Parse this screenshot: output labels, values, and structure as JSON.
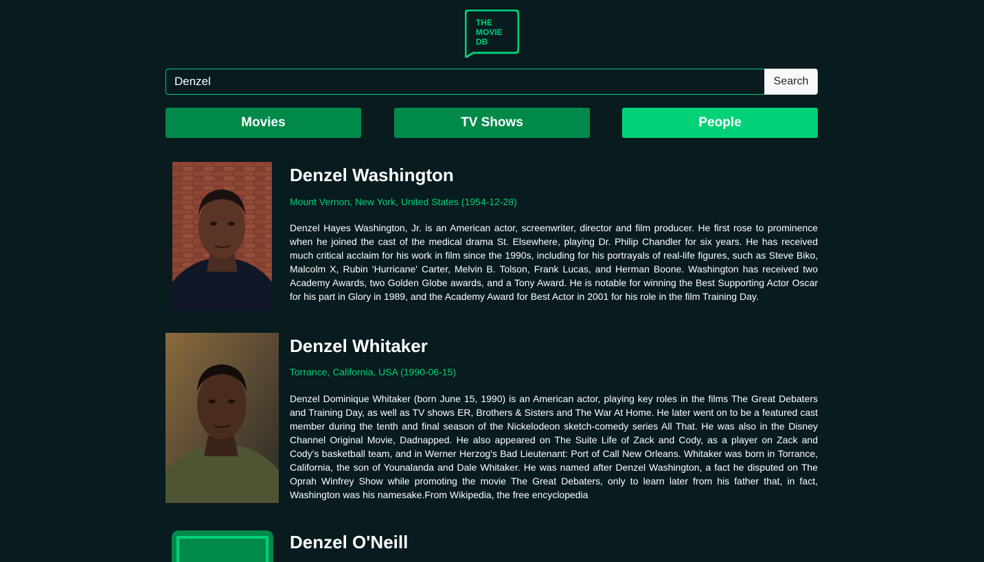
{
  "logo": {
    "line1": "THE",
    "line2": "MOVIE",
    "line3": "DB"
  },
  "search": {
    "value": "Denzel",
    "button_label": "Search"
  },
  "tabs": [
    {
      "label": "Movies",
      "active": false
    },
    {
      "label": "TV Shows",
      "active": false
    },
    {
      "label": "People",
      "active": true
    }
  ],
  "people": [
    {
      "name": "Denzel Washington",
      "meta": "Mount Vernon, New York, United States (1954-12-28)",
      "bio": "Denzel Hayes Washington, Jr. is an American actor, screenwriter, director and film producer. He first rose to prominence when he joined the cast of the medical drama St. Elsewhere, playing Dr. Philip Chandler for six years. He has received much critical acclaim for his work in film since the 1990s, including for his portrayals of real-life figures, such as Steve Biko, Malcolm X, Rubin 'Hurricane' Carter, Melvin B. Tolson, Frank Lucas, and Herman Boone. Washington has received two Academy Awards, two Golden Globe awards, and a Tony Award. He is notable for winning the Best Supporting Actor Oscar for his part in Glory in 1989, and the Academy Award for Best Actor in 2001 for his role in the film Training Day."
    },
    {
      "name": "Denzel Whitaker",
      "meta": "Torrance, California, USA (1990-06-15)",
      "bio": "Denzel Dominique Whitaker (born June 15, 1990) is an American actor, playing key roles in the films The Great Debaters and Training Day, as well as TV shows ER, Brothers & Sisters and The War At Home. He later went on to be a featured cast member during the tenth and final season of the Nickelodeon sketch-comedy series All That. He was also in the Disney Channel Original Movie, Dadnapped. He also appeared on The Suite Life of Zack and Cody, as a player on Zack and Cody's basketball team, and in Werner Herzog's Bad Lieutenant: Port of Call New Orleans. Whitaker was born in Torrance, California, the son of Younalanda and Dale Whitaker. He was named after Denzel Washington, a fact he disputed on The Oprah Winfrey Show while promoting the movie The Great Debaters, only to learn later from his father that, in fact, Washington was his namesake.From Wikipedia, the free encyclopedia"
    },
    {
      "name": "Denzel O'Neill",
      "meta": "",
      "bio": ""
    }
  ],
  "colors": {
    "background": "#081b1f",
    "accent": "#01d277",
    "tab_inactive": "#01894a"
  }
}
